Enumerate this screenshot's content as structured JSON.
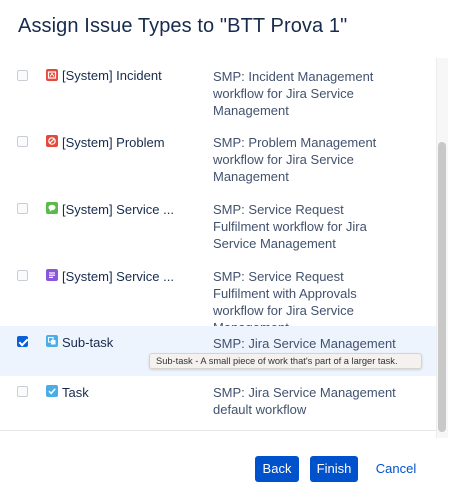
{
  "dialog": {
    "title": "Assign Issue Types to \"BTT Prova 1\""
  },
  "issue_types": [
    {
      "name": "[System] Incident",
      "icon": "incident-icon",
      "icon_color": "#e5493a",
      "checked": false,
      "workflow": "SMP: Incident Management workflow for Jira Service Management"
    },
    {
      "name": "[System] Problem",
      "icon": "problem-icon",
      "icon_color": "#e5493a",
      "checked": false,
      "workflow": "SMP: Problem Management workflow for Jira Service Management"
    },
    {
      "name": "[System] Service ...",
      "icon": "service-request-icon",
      "icon_color": "#5bba4a",
      "checked": false,
      "workflow": "SMP: Service Request Fulfilment workflow for Jira Service Management"
    },
    {
      "name": "[System] Service ...",
      "icon": "service-request-approvals-icon",
      "icon_color": "#8b56d9",
      "checked": false,
      "workflow": "SMP: Service Request Fulfilment with Approvals workflow for Jira Service Management"
    },
    {
      "name": "Sub-task",
      "icon": "subtask-icon",
      "icon_color": "#4bade8",
      "checked": true,
      "workflow": "SMP: Jira Service Management"
    },
    {
      "name": "Task",
      "icon": "task-icon",
      "icon_color": "#4bade8",
      "checked": false,
      "workflow": "SMP: Jira Service Management default workflow"
    }
  ],
  "tooltip": "Sub-task - A small piece of work that's part of a larger task.",
  "footer": {
    "back_label": "Back",
    "finish_label": "Finish",
    "cancel_label": "Cancel"
  },
  "colors": {
    "primary": "#0052cc",
    "selected_row": "#eef4fd"
  }
}
